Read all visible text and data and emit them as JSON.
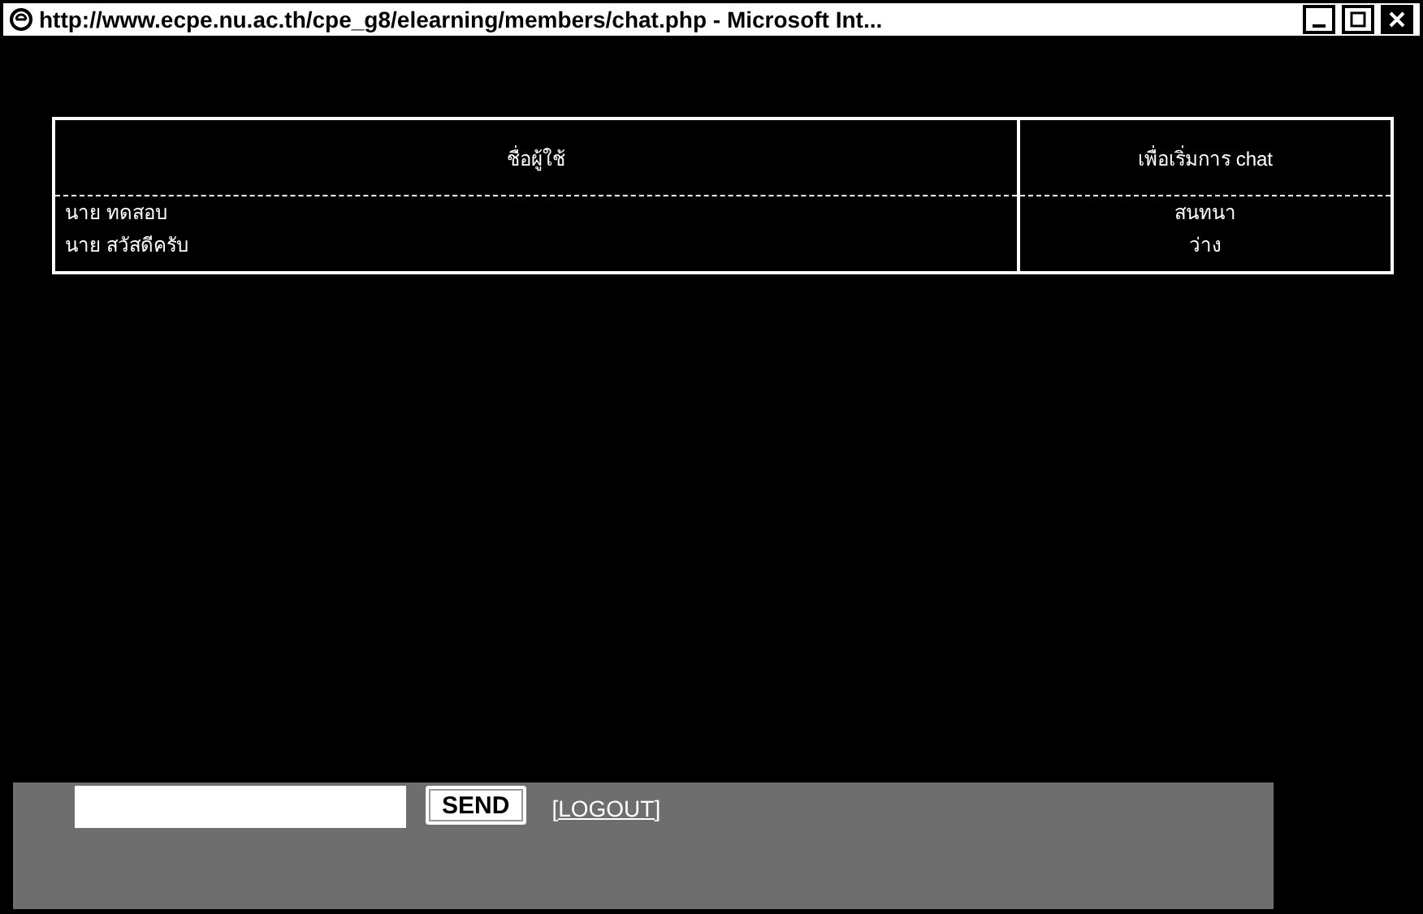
{
  "window": {
    "title": "http://www.ecpe.nu.ac.th/cpe_g8/elearning/members/chat.php - Microsoft Int..."
  },
  "table": {
    "columns": [
      "ชื่อผู้ใช้",
      "เพื่อเริ่มการ chat"
    ],
    "rows": [
      {
        "cells": [
          "นาย ทดสอบ",
          "สนทนา"
        ]
      },
      {
        "cells": [
          "นาย สวัสดีครับ",
          "ว่าง"
        ]
      }
    ]
  },
  "chat_form": {
    "send_button": "SEND",
    "logout_link": "[LOGOUT]"
  }
}
